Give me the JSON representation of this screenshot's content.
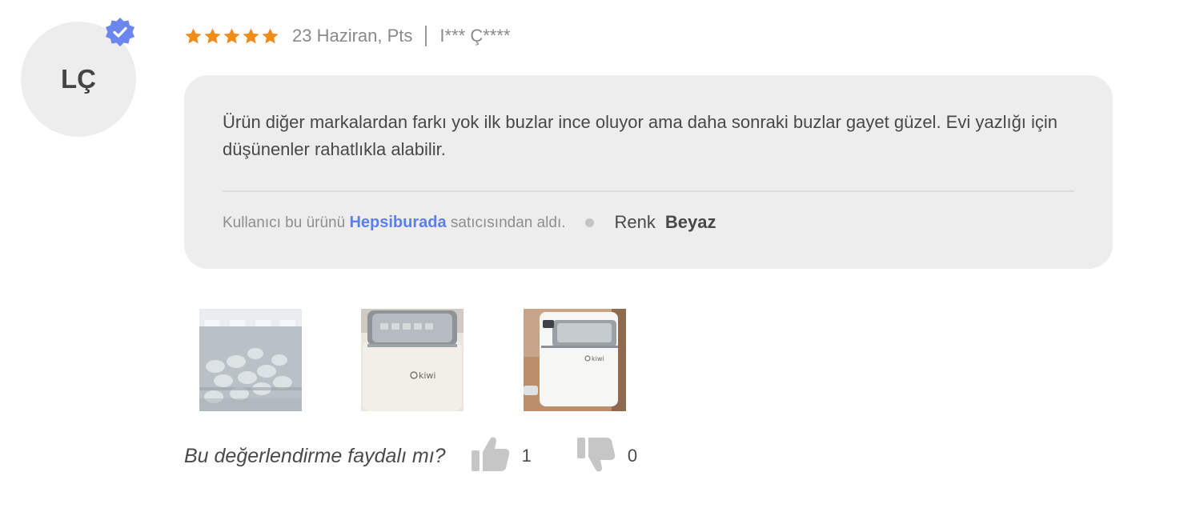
{
  "review": {
    "avatar_initials": "LÇ",
    "verified_icon": "verified-check-icon",
    "rating": 5,
    "rating_max": 5,
    "date": "23 Haziran, Pts",
    "author": "I*** Ç****",
    "comment": "Ürün diğer markalardan farkı yok ilk buzlar ince oluyor ama daha sonraki buzlar gayet güzel. Evi yazlığı için düşünenler rahatlıkla alabilir.",
    "seller_prefix": "Kullanıcı bu ürünü",
    "seller_name": "Hepsiburada",
    "seller_suffix": "satıcısından aldı.",
    "color_label": "Renk",
    "color_value": "Beyaz",
    "photos": [
      {
        "name": "photo-ice-cubes"
      },
      {
        "name": "photo-ice-maker-front"
      },
      {
        "name": "photo-ice-maker-side"
      }
    ],
    "helpful_question": "Bu değerlendirme faydalı mı?",
    "likes": "1",
    "dislikes": "0"
  },
  "colors": {
    "star": "#f28b1c",
    "link": "#5c7ff0",
    "verified": "#6b86ee",
    "bubble": "#ededed",
    "avatar_bg": "#ededed"
  }
}
